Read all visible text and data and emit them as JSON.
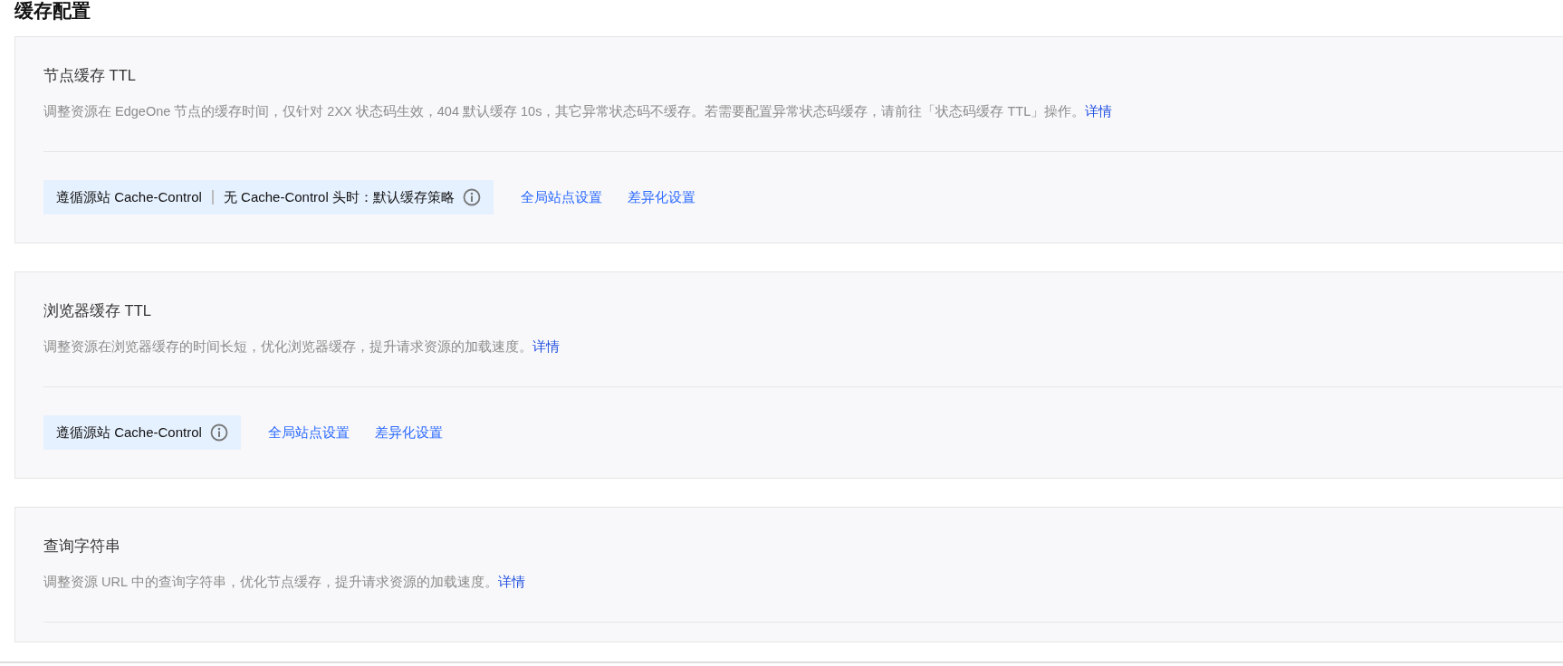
{
  "page_title": "缓存配置",
  "sections": [
    {
      "title": "节点缓存 TTL",
      "description": "调整资源在 EdgeOne 节点的缓存时间，仅针对 2XX 状态码生效，404 默认缓存 10s，其它异常状态码不缓存。若需要配置异常状态码缓存，请前往「状态码缓存 TTL」操作。",
      "detail_link": "详情",
      "policy": [
        "遵循源站 Cache-Control",
        "无 Cache-Control 头时：默认缓存策略"
      ],
      "actions": [
        "全局站点设置",
        "差异化设置"
      ]
    },
    {
      "title": "浏览器缓存 TTL",
      "description": "调整资源在浏览器缓存的时间长短，优化浏览器缓存，提升请求资源的加载速度。",
      "detail_link": "详情",
      "policy": [
        "遵循源站 Cache-Control"
      ],
      "actions": [
        "全局站点设置",
        "差异化设置"
      ]
    },
    {
      "title": "查询字符串",
      "description": "调整资源 URL 中的查询字符串，优化节点缓存，提升请求资源的加载速度。",
      "detail_link": "详情"
    }
  ]
}
